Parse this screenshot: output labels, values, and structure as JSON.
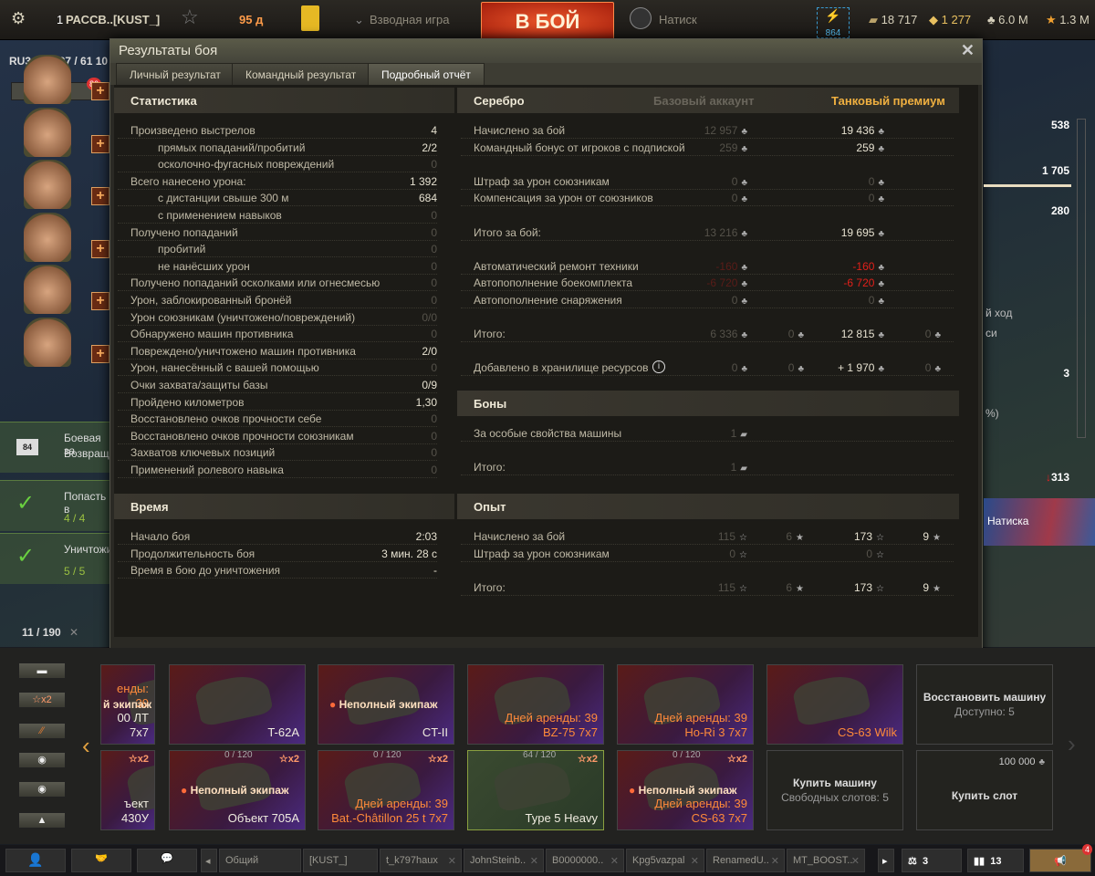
{
  "topbar": {
    "player": "РАССВ..[KUST_]",
    "rank": "1",
    "premium_days": "95 д",
    "platoon": "Взводная игра",
    "battle": "В БОЙ",
    "mode": "Натиск",
    "boosters": "864",
    "bonds": "18 717",
    "gold": "1 277",
    "credits": "6.0 M",
    "free_xp": "1.3 M"
  },
  "server": "RU3: 19 297 / 61 10",
  "notif_count": "86",
  "dialog": {
    "title": "Результаты боя",
    "tabs": [
      "Личный результат",
      "Командный результат",
      "Подробный отчёт"
    ],
    "active_tab": 2
  },
  "stats": {
    "title": "Статистика",
    "rows": [
      {
        "label": "Произведено выстрелов",
        "value": "4"
      },
      {
        "label": "прямых попаданий/пробитий",
        "value": "2/2",
        "indent": true
      },
      {
        "label": "осколочно-фугасных повреждений",
        "value": "0",
        "indent": true
      },
      {
        "label": "Всего нанесено урона:",
        "value": "1 392"
      },
      {
        "label": "с дистанции свыше 300 м",
        "value": "684",
        "indent": true
      },
      {
        "label": "с применением навыков",
        "value": "0",
        "indent": true
      },
      {
        "label": "Получено попаданий",
        "value": "0"
      },
      {
        "label": "пробитий",
        "value": "0",
        "indent": true
      },
      {
        "label": "не нанёсших урон",
        "value": "0",
        "indent": true
      },
      {
        "label": "Получено попаданий осколками или огнесмесью",
        "value": "0"
      },
      {
        "label": "Урон, заблокированный бронёй",
        "value": "0"
      },
      {
        "label": "Урон союзникам (уничтожено/повреждений)",
        "value": "0/0"
      },
      {
        "label": "Обнаружено машин противника",
        "value": "0"
      },
      {
        "label": "Повреждено/уничтожено машин противника",
        "value": "2/0"
      },
      {
        "label": "Урон, нанесённый с вашей помощью",
        "value": "0"
      },
      {
        "label": "Очки захвата/защиты базы",
        "value": "0/9"
      },
      {
        "label": "Пройдено километров",
        "value": "1,30"
      },
      {
        "label": "Восстановлено очков прочности себе",
        "value": "0"
      },
      {
        "label": "Восстановлено очков прочности союзникам",
        "value": "0"
      },
      {
        "label": "Захватов ключевых позиций",
        "value": "0"
      },
      {
        "label": "Применений ролевого навыка",
        "value": "0"
      }
    ]
  },
  "time": {
    "title": "Время",
    "rows": [
      {
        "label": "Начало боя",
        "value": "2:03"
      },
      {
        "label": "Продолжительность боя",
        "value": "3 мин. 28 с"
      },
      {
        "label": "Время в бою до уничтожения",
        "value": "-"
      }
    ]
  },
  "silver": {
    "title": "Серебро",
    "base_header": "Базовый аккаунт",
    "premium_header": "Танковый премиум",
    "rows": [
      {
        "label": "Начислено за бой",
        "base": "12 957",
        "prem": "19 436"
      },
      {
        "label": "Командный бонус от игроков с подпиской",
        "base": "259",
        "prem": "259"
      },
      {
        "gap": true
      },
      {
        "label": "Штраф за урон союзникам",
        "base": "0",
        "prem": "0"
      },
      {
        "label": "Компенсация за урон от союзников",
        "base": "0",
        "prem": "0"
      },
      {
        "gap": true
      },
      {
        "label": "Итого за бой:",
        "base": "13 216",
        "prem": "19 695"
      },
      {
        "gap": true
      },
      {
        "label": "Автоматический ремонт техники",
        "base": "-160",
        "prem": "-160",
        "neg": true
      },
      {
        "label": "Автопополнение боекомплекта",
        "base": "-6 720",
        "prem": "-6 720",
        "neg": true
      },
      {
        "label": "Автопополнение снаряжения",
        "base": "0",
        "prem": "0"
      },
      {
        "gap": true
      },
      {
        "label": "Итого:",
        "base": "6 336",
        "base_gold": "0",
        "prem": "12 815",
        "prem_gold": "0"
      },
      {
        "gap": true
      },
      {
        "label": "Добавлено в хранилище ресурсов",
        "info": true,
        "base": "0",
        "base_gold": "0",
        "prem": "+ 1 970",
        "prem_gold": "0"
      }
    ]
  },
  "bonds": {
    "title": "Боны",
    "rows": [
      {
        "label": "За особые свойства машины",
        "base": "1"
      },
      {
        "gap": true
      },
      {
        "label": "Итого:",
        "base": "1"
      }
    ]
  },
  "xp": {
    "title": "Опыт",
    "rows": [
      {
        "label": "Начислено за бой",
        "base": "115",
        "base_gold": "6",
        "prem": "173",
        "prem_gold": "9"
      },
      {
        "label": "Штраф за урон союзникам",
        "base": "0",
        "prem": "0"
      },
      {
        "gap": true
      },
      {
        "label": "Итого:",
        "base": "115",
        "base_gold": "6",
        "prem": "173",
        "prem_gold": "9"
      }
    ]
  },
  "right_panel": {
    "values": [
      "538",
      "1 705",
      "280",
      "3"
    ],
    "text1": "й ход",
    "text2": "си",
    "text3": "%)",
    "rating": "313",
    "onslaught": "Натиска"
  },
  "quests": [
    {
      "badge": "84",
      "line1": "Боевая за",
      "line2": "Возвраща"
    },
    {
      "title": "Попасть в",
      "progress": "4 / 4"
    },
    {
      "title": "Уничтожи",
      "progress": "5 / 5"
    }
  ],
  "garage_count": "11 / 190",
  "filters": [
    "x2"
  ],
  "cards": [
    {
      "row": 0,
      "name": "00 ЛТ 7x7",
      "rent": "енды: 39",
      "crew": "й экипаж",
      "partial": true
    },
    {
      "row": 0,
      "name": "T-62A"
    },
    {
      "row": 0,
      "name": "CT-II",
      "crew": "Неполный экипаж"
    },
    {
      "row": 0,
      "name": "BZ-75 7x7",
      "rent": "Дней аренды: 39",
      "orange": true
    },
    {
      "row": 0,
      "name": "Ho-Ri 3 7x7",
      "rent": "Дней аренды: 39",
      "orange": true
    },
    {
      "row": 0,
      "name": "CS-63 Wilk",
      "orange": true
    },
    {
      "row": 0,
      "name": "Восстановить машину",
      "sub": "Доступно: 5",
      "grey": true
    },
    {
      "row": 1,
      "name": "ъект 430У",
      "x2": "x2",
      "partial": true
    },
    {
      "row": 1,
      "name": "Объект 705А",
      "crew": "Неполный экипаж",
      "count": "0 / 120",
      "x2": "x2"
    },
    {
      "row": 1,
      "name": "Bat.-Châtillon 25 t 7x7",
      "rent": "Дней аренды: 39",
      "count": "0 / 120",
      "x2": "x2",
      "orange": true
    },
    {
      "row": 1,
      "name": "Type 5 Heavy",
      "count": "64 / 120",
      "x2": "x2"
    },
    {
      "row": 1,
      "name": "CS-63 7x7",
      "rent": "Дней аренды: 39",
      "crew": "Неполный экипаж",
      "count": "0 / 120",
      "x2": "x2",
      "orange": true
    },
    {
      "row": 1,
      "name": "Купить машину",
      "sub": "Свободных слотов: 5",
      "grey": true
    },
    {
      "row": 1,
      "name": "Купить слот",
      "price": "100 000",
      "grey": true
    }
  ],
  "chat": {
    "tabs": [
      "Общий",
      "[KUST_]",
      "t_k797haux",
      "JohnSteinb..",
      "B0000000..",
      "Kpg5vazpal",
      "RenamedU..",
      "MT_BOOST.."
    ],
    "balance": "3",
    "stats": "13",
    "notif": "4"
  }
}
